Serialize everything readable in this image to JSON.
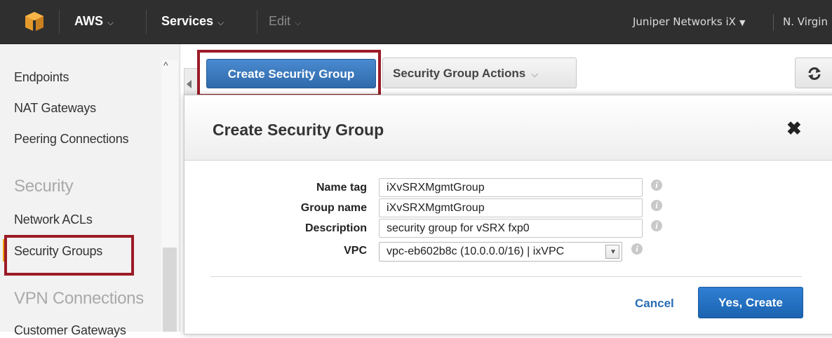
{
  "topbar": {
    "aws_label": "AWS",
    "services_label": "Services",
    "edit_label": "Edit",
    "account_label": "Juniper Networks iX",
    "region_label": "N. Virgin"
  },
  "sidebar": {
    "items": [
      {
        "label": "Endpoints"
      },
      {
        "label": "NAT Gateways"
      },
      {
        "label": "Peering Connections"
      },
      {
        "label": "Network ACLs"
      },
      {
        "label": "Security Groups"
      },
      {
        "label": "Customer Gateways"
      }
    ],
    "sections": [
      {
        "label": "Security"
      },
      {
        "label": "VPN Connections"
      }
    ]
  },
  "toolbar": {
    "create_label": "Create Security Group",
    "actions_label": "Security Group Actions"
  },
  "modal": {
    "title": "Create Security Group",
    "close_glyph": "✖",
    "fields": {
      "name_tag": {
        "label": "Name tag",
        "value": "iXvSRXMgmtGroup"
      },
      "group_name": {
        "label": "Group name",
        "value": "iXvSRXMgmtGroup"
      },
      "description": {
        "label": "Description",
        "value": "security group for vSRX fxp0"
      },
      "vpc": {
        "label": "VPC",
        "value": "vpc-eb602b8c (10.0.0.0/16) | ixVPC"
      }
    },
    "cancel_label": "Cancel",
    "create_label": "Yes, Create"
  },
  "colors": {
    "topbar_bg": "#2f2f2f",
    "primary_button": "#3d7bbf",
    "highlight_border": "#9b1c27",
    "link": "#2a6db5"
  },
  "icons": [
    "aws-cube-icon",
    "chevron-down-icon",
    "refresh-icon",
    "close-icon",
    "info-icon",
    "collapse-arrow-icon"
  ]
}
